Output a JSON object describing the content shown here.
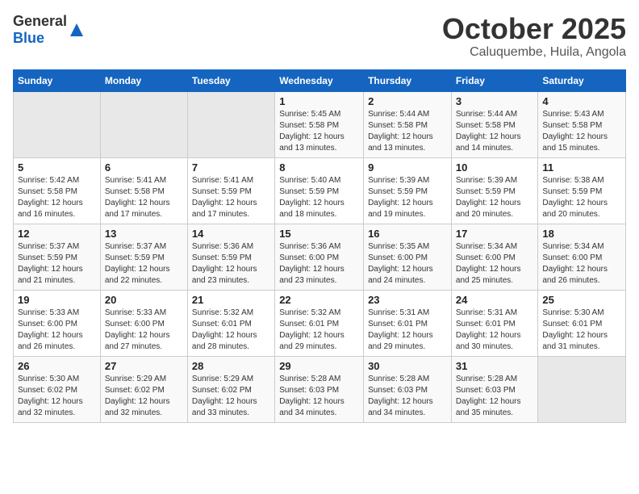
{
  "logo": {
    "general": "General",
    "blue": "Blue"
  },
  "header": {
    "month": "October 2025",
    "location": "Caluquembe, Huila, Angola"
  },
  "weekdays": [
    "Sunday",
    "Monday",
    "Tuesday",
    "Wednesday",
    "Thursday",
    "Friday",
    "Saturday"
  ],
  "weeks": [
    [
      {
        "day": "",
        "info": ""
      },
      {
        "day": "",
        "info": ""
      },
      {
        "day": "",
        "info": ""
      },
      {
        "day": "1",
        "info": "Sunrise: 5:45 AM\nSunset: 5:58 PM\nDaylight: 12 hours and 13 minutes."
      },
      {
        "day": "2",
        "info": "Sunrise: 5:44 AM\nSunset: 5:58 PM\nDaylight: 12 hours and 13 minutes."
      },
      {
        "day": "3",
        "info": "Sunrise: 5:44 AM\nSunset: 5:58 PM\nDaylight: 12 hours and 14 minutes."
      },
      {
        "day": "4",
        "info": "Sunrise: 5:43 AM\nSunset: 5:58 PM\nDaylight: 12 hours and 15 minutes."
      }
    ],
    [
      {
        "day": "5",
        "info": "Sunrise: 5:42 AM\nSunset: 5:58 PM\nDaylight: 12 hours and 16 minutes."
      },
      {
        "day": "6",
        "info": "Sunrise: 5:41 AM\nSunset: 5:58 PM\nDaylight: 12 hours and 17 minutes."
      },
      {
        "day": "7",
        "info": "Sunrise: 5:41 AM\nSunset: 5:59 PM\nDaylight: 12 hours and 17 minutes."
      },
      {
        "day": "8",
        "info": "Sunrise: 5:40 AM\nSunset: 5:59 PM\nDaylight: 12 hours and 18 minutes."
      },
      {
        "day": "9",
        "info": "Sunrise: 5:39 AM\nSunset: 5:59 PM\nDaylight: 12 hours and 19 minutes."
      },
      {
        "day": "10",
        "info": "Sunrise: 5:39 AM\nSunset: 5:59 PM\nDaylight: 12 hours and 20 minutes."
      },
      {
        "day": "11",
        "info": "Sunrise: 5:38 AM\nSunset: 5:59 PM\nDaylight: 12 hours and 20 minutes."
      }
    ],
    [
      {
        "day": "12",
        "info": "Sunrise: 5:37 AM\nSunset: 5:59 PM\nDaylight: 12 hours and 21 minutes."
      },
      {
        "day": "13",
        "info": "Sunrise: 5:37 AM\nSunset: 5:59 PM\nDaylight: 12 hours and 22 minutes."
      },
      {
        "day": "14",
        "info": "Sunrise: 5:36 AM\nSunset: 5:59 PM\nDaylight: 12 hours and 23 minutes."
      },
      {
        "day": "15",
        "info": "Sunrise: 5:36 AM\nSunset: 6:00 PM\nDaylight: 12 hours and 23 minutes."
      },
      {
        "day": "16",
        "info": "Sunrise: 5:35 AM\nSunset: 6:00 PM\nDaylight: 12 hours and 24 minutes."
      },
      {
        "day": "17",
        "info": "Sunrise: 5:34 AM\nSunset: 6:00 PM\nDaylight: 12 hours and 25 minutes."
      },
      {
        "day": "18",
        "info": "Sunrise: 5:34 AM\nSunset: 6:00 PM\nDaylight: 12 hours and 26 minutes."
      }
    ],
    [
      {
        "day": "19",
        "info": "Sunrise: 5:33 AM\nSunset: 6:00 PM\nDaylight: 12 hours and 26 minutes."
      },
      {
        "day": "20",
        "info": "Sunrise: 5:33 AM\nSunset: 6:00 PM\nDaylight: 12 hours and 27 minutes."
      },
      {
        "day": "21",
        "info": "Sunrise: 5:32 AM\nSunset: 6:01 PM\nDaylight: 12 hours and 28 minutes."
      },
      {
        "day": "22",
        "info": "Sunrise: 5:32 AM\nSunset: 6:01 PM\nDaylight: 12 hours and 29 minutes."
      },
      {
        "day": "23",
        "info": "Sunrise: 5:31 AM\nSunset: 6:01 PM\nDaylight: 12 hours and 29 minutes."
      },
      {
        "day": "24",
        "info": "Sunrise: 5:31 AM\nSunset: 6:01 PM\nDaylight: 12 hours and 30 minutes."
      },
      {
        "day": "25",
        "info": "Sunrise: 5:30 AM\nSunset: 6:01 PM\nDaylight: 12 hours and 31 minutes."
      }
    ],
    [
      {
        "day": "26",
        "info": "Sunrise: 5:30 AM\nSunset: 6:02 PM\nDaylight: 12 hours and 32 minutes."
      },
      {
        "day": "27",
        "info": "Sunrise: 5:29 AM\nSunset: 6:02 PM\nDaylight: 12 hours and 32 minutes."
      },
      {
        "day": "28",
        "info": "Sunrise: 5:29 AM\nSunset: 6:02 PM\nDaylight: 12 hours and 33 minutes."
      },
      {
        "day": "29",
        "info": "Sunrise: 5:28 AM\nSunset: 6:03 PM\nDaylight: 12 hours and 34 minutes."
      },
      {
        "day": "30",
        "info": "Sunrise: 5:28 AM\nSunset: 6:03 PM\nDaylight: 12 hours and 34 minutes."
      },
      {
        "day": "31",
        "info": "Sunrise: 5:28 AM\nSunset: 6:03 PM\nDaylight: 12 hours and 35 minutes."
      },
      {
        "day": "",
        "info": ""
      }
    ]
  ]
}
